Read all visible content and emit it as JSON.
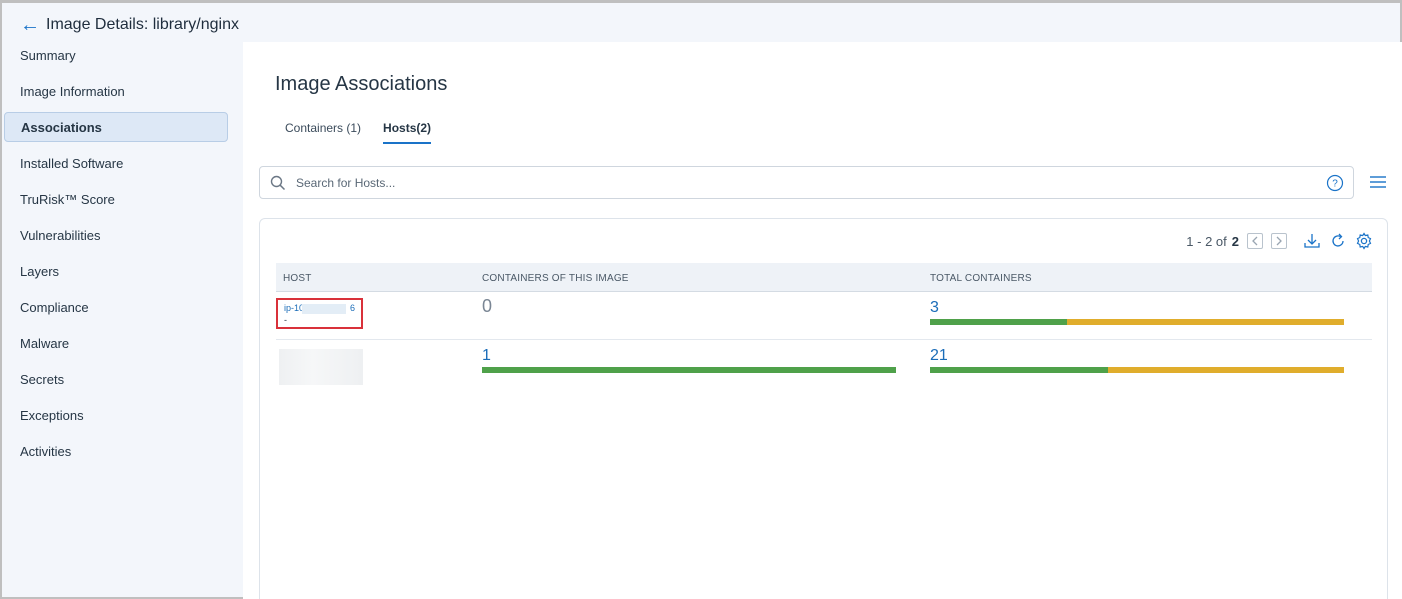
{
  "header": {
    "title": "Image Details: library/nginx"
  },
  "sidebar": {
    "items": [
      {
        "label": "Summary",
        "active": false
      },
      {
        "label": "Image Information",
        "active": false
      },
      {
        "label": "Associations",
        "active": true
      },
      {
        "label": "Installed Software",
        "active": false
      },
      {
        "label": "TruRisk™ Score",
        "active": false
      },
      {
        "label": "Vulnerabilities",
        "active": false
      },
      {
        "label": "Layers",
        "active": false
      },
      {
        "label": "Compliance",
        "active": false
      },
      {
        "label": "Malware",
        "active": false
      },
      {
        "label": "Secrets",
        "active": false
      },
      {
        "label": "Exceptions",
        "active": false
      },
      {
        "label": "Activities",
        "active": false
      }
    ]
  },
  "main": {
    "title": "Image Associations",
    "tabs": [
      {
        "label": "Containers (1)",
        "active": false
      },
      {
        "label": "Hosts(2)",
        "active": true
      }
    ],
    "search": {
      "placeholder": "Search for Hosts..."
    },
    "pager": {
      "range": "1 - 2 of",
      "total": "2"
    },
    "table": {
      "columns": [
        "HOST",
        "CONTAINERS OF THIS IMAGE",
        "TOTAL CONTAINERS"
      ],
      "rows": [
        {
          "host_prefix": "ip-10",
          "host_suffix": "6",
          "host_sub": "-",
          "containers_of_image": "0",
          "total_containers": "3",
          "total_green_fraction": 0.33
        },
        {
          "host_prefix": "",
          "host_suffix": "",
          "host_sub": "",
          "containers_of_image": "1",
          "containers_green_fraction": 1.0,
          "total_containers": "21",
          "total_green_fraction": 0.43
        }
      ]
    }
  },
  "colors": {
    "accent": "#1a73c8",
    "bar_green": "#4fa14a",
    "bar_yellow": "#e0ad2c",
    "highlight_border": "#d9313a"
  },
  "icons": [
    "back-arrow-icon",
    "search-icon",
    "help-icon",
    "menu-icon",
    "chevron-left-icon",
    "chevron-right-icon",
    "download-icon",
    "refresh-icon",
    "gear-icon"
  ]
}
